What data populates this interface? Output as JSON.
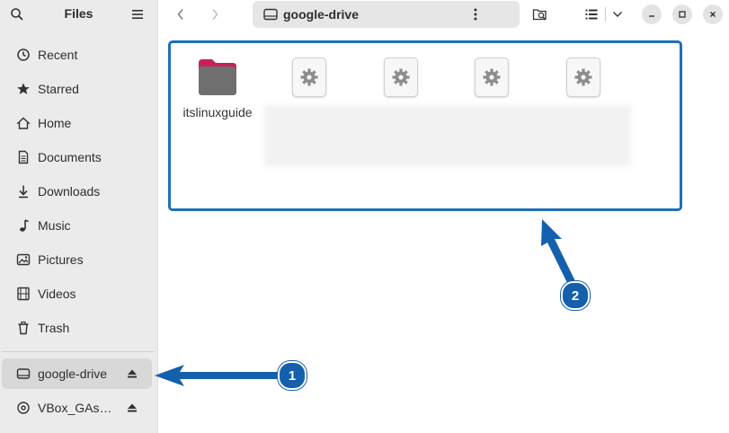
{
  "sidebar": {
    "title": "Files",
    "items": [
      {
        "label": "Recent",
        "icon": "clock-icon"
      },
      {
        "label": "Starred",
        "icon": "star-icon"
      },
      {
        "label": "Home",
        "icon": "home-icon"
      },
      {
        "label": "Documents",
        "icon": "document-icon"
      },
      {
        "label": "Downloads",
        "icon": "download-icon"
      },
      {
        "label": "Music",
        "icon": "music-note-icon"
      },
      {
        "label": "Pictures",
        "icon": "picture-icon"
      },
      {
        "label": "Videos",
        "icon": "film-icon"
      },
      {
        "label": "Trash",
        "icon": "trash-icon"
      }
    ],
    "devices": [
      {
        "label": "google-drive",
        "icon": "drive-icon",
        "active": true
      },
      {
        "label": "VBox_GAs…",
        "icon": "disc-icon",
        "active": false
      }
    ]
  },
  "toolbar": {
    "location": "google-drive"
  },
  "content": {
    "folder_name": "itslinuxguide",
    "folder_color": "#c7205a",
    "highlight_color": "#1f6fb8"
  },
  "annotations": {
    "badge1": "1",
    "badge2": "2"
  }
}
